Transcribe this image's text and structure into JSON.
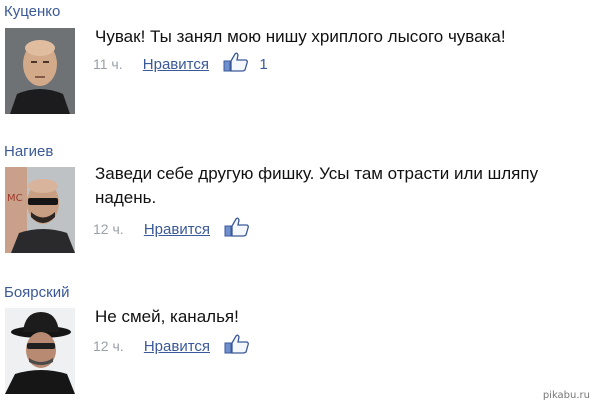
{
  "comments": [
    {
      "author": "Куценко",
      "text": "Чувак! Ты занял мою нишу хриплого лысого чувака!",
      "time": "11 ч.",
      "like_label": "Нравится",
      "like_count": "1"
    },
    {
      "author": "Нагиев",
      "text": "Заведи себе другую фишку. Усы там отрасти или шляпу надень.",
      "time": "12 ч.",
      "like_label": "Нравится",
      "like_count": ""
    },
    {
      "author": "Боярский",
      "text": "Не смей, каналья!",
      "time": "12 ч.",
      "like_label": "Нравится",
      "like_count": ""
    }
  ],
  "watermark": "pikabu.ru",
  "colors": {
    "link": "#3b5998",
    "muted": "#9aa0a8",
    "text": "#111111"
  },
  "icons": {
    "like": "thumbs-up-icon"
  }
}
